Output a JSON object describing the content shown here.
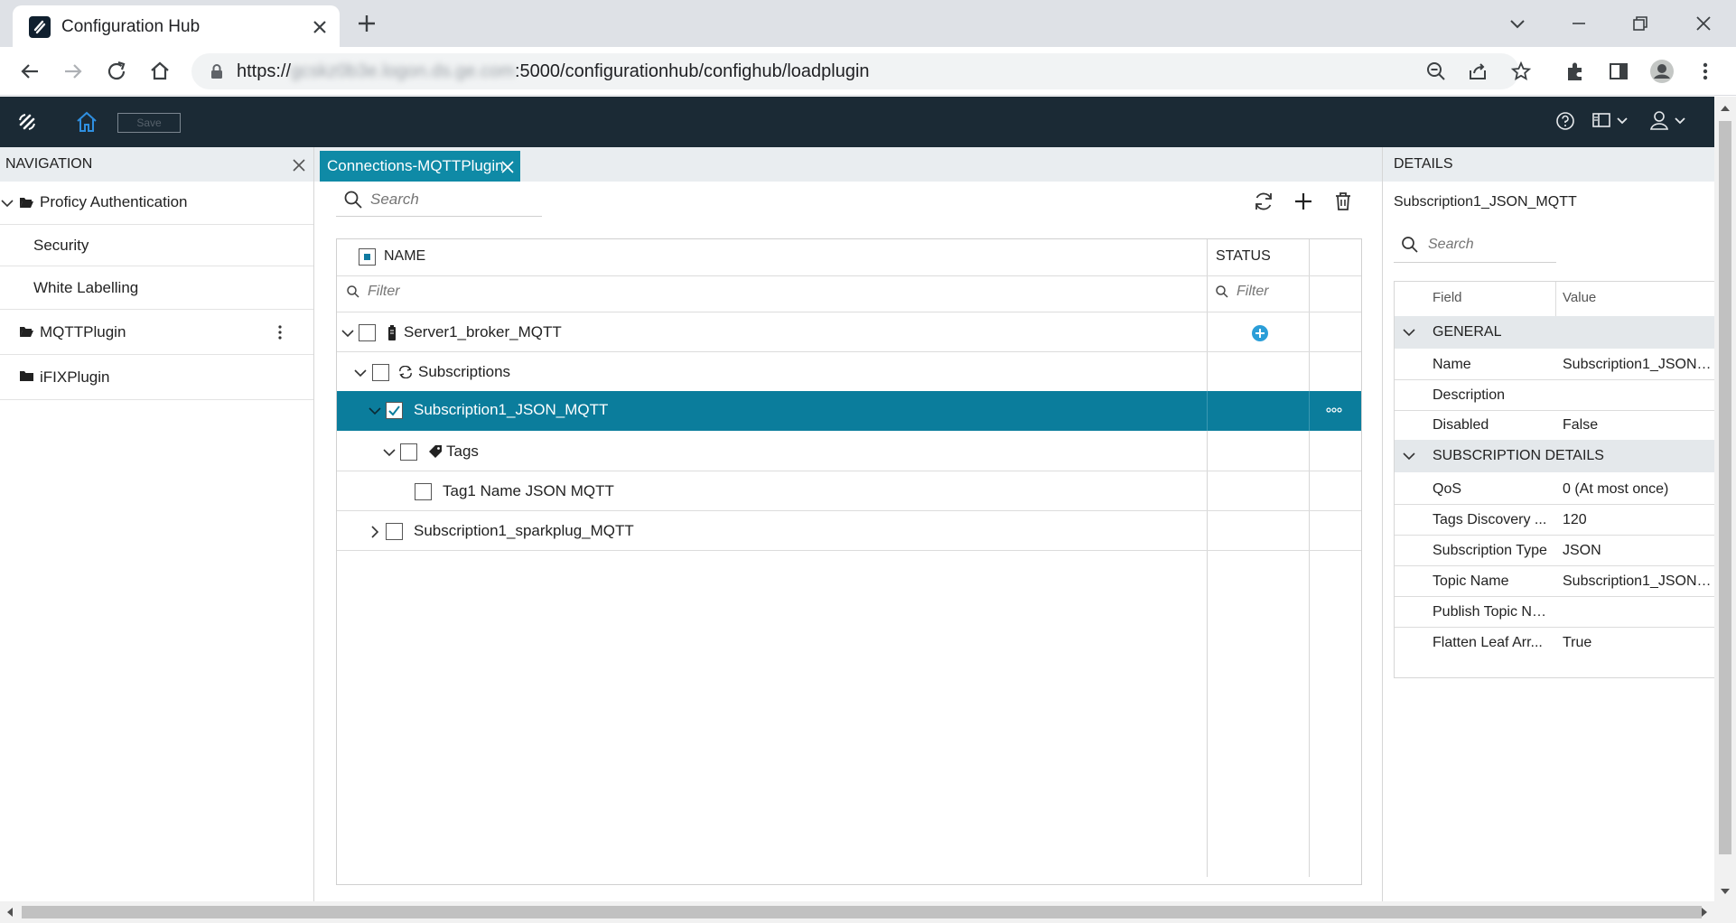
{
  "browser": {
    "tab_title": "Configuration Hub",
    "url_prefix": "https://",
    "url_host_blurred": "gcskz0b3e.logon.ds.ge.com",
    "url_rest": ":5000/configurationhub/confighub/loadplugin"
  },
  "app": {
    "save_label": "Save"
  },
  "navigation": {
    "title": "NAVIGATION",
    "items": [
      {
        "label": "Proficy Authentication"
      },
      {
        "label": "Security"
      },
      {
        "label": "White Labelling"
      },
      {
        "label": "MQTTPlugin"
      },
      {
        "label": "iFIXPlugin"
      }
    ]
  },
  "center": {
    "tab_label": "Connections-MQTTPlugin",
    "search_placeholder": "Search",
    "grid": {
      "col_name": "NAME",
      "col_status": "STATUS",
      "filter_placeholder": "Filter",
      "rows": [
        {
          "label": "Server1_broker_MQTT"
        },
        {
          "label": "Subscriptions"
        },
        {
          "label": "Subscription1_JSON_MQTT",
          "selected": true
        },
        {
          "label": "Tags"
        },
        {
          "label": "Tag1 Name JSON MQTT"
        },
        {
          "label": "Subscription1_sparkplug_MQTT"
        }
      ]
    }
  },
  "details": {
    "title": "DETAILS",
    "subtitle": "Subscription1_JSON_MQTT",
    "search_placeholder": "Search",
    "col_field": "Field",
    "col_value": "Value",
    "groups": [
      {
        "title": "GENERAL",
        "rows": [
          {
            "field": "Name",
            "value": "Subscription1_JSON_MQTT"
          },
          {
            "field": "Description",
            "value": ""
          },
          {
            "field": "Disabled",
            "value": "False"
          }
        ]
      },
      {
        "title": "SUBSCRIPTION DETAILS",
        "rows": [
          {
            "field": "QoS",
            "value": "0 (At most once)"
          },
          {
            "field": "Tags Discovery ...",
            "value": "120"
          },
          {
            "field": "Subscription Type",
            "value": "JSON"
          },
          {
            "field": "Topic Name",
            "value": "Subscription1_JSON_MQTT"
          },
          {
            "field": "Publish Topic Na...",
            "value": ""
          },
          {
            "field": "Flatten Leaf Arr...",
            "value": "True"
          }
        ]
      }
    ]
  },
  "colors": {
    "app_header": "#1b2a35",
    "accent": "#0f8aa6",
    "selected_row": "#0b7d9c",
    "add_icon": "#2b9ed8"
  }
}
